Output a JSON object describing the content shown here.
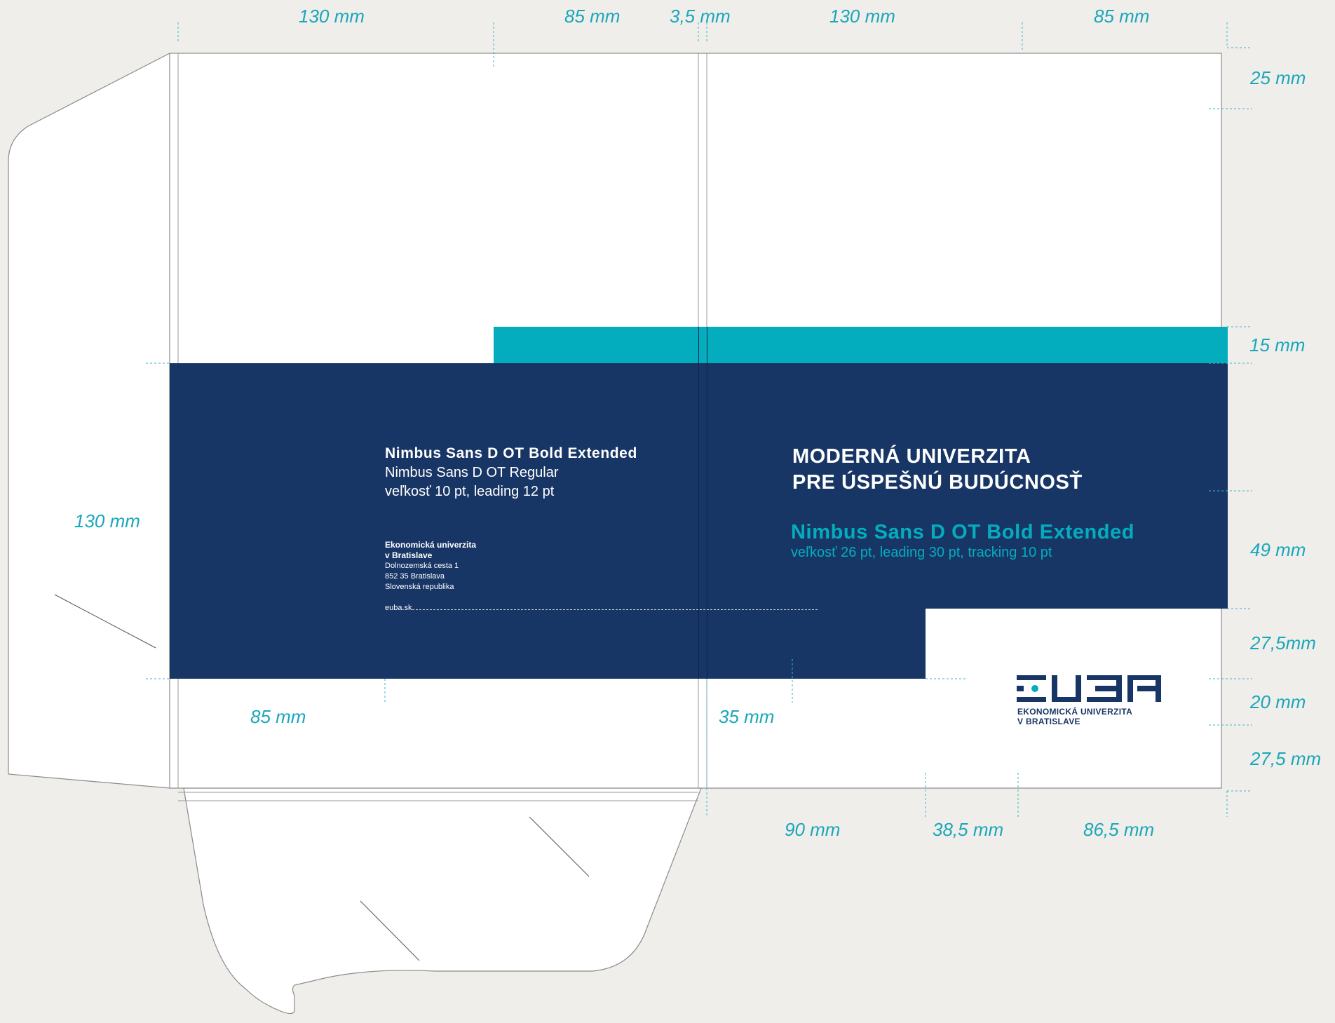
{
  "dimensions": {
    "top": [
      "130 mm",
      "85 mm",
      "3,5 mm",
      "130 mm",
      "85 mm"
    ],
    "right": [
      "25 mm",
      "15 mm",
      "49 mm",
      "27,5mm",
      "20 mm",
      "27,5 mm"
    ],
    "left": "130 mm",
    "bottom_left": [
      "85 mm",
      "35 mm"
    ],
    "bottom_right": [
      "90 mm",
      "38,5 mm",
      "86,5 mm"
    ]
  },
  "inner_panel": {
    "font_bold": "Nimbus Sans D OT Bold Extended",
    "font_regular": "Nimbus Sans D OT Regular",
    "font_spec": "veľkosť 10 pt, leading 12 pt",
    "address": {
      "line1": "Ekonomická univerzita",
      "line2": "v Bratislave",
      "line3": "Dolnozemská cesta 1",
      "line4": "852 35 Bratislava",
      "line5": "Slovenská republika"
    },
    "web": "euba.sk"
  },
  "cover": {
    "headline_line1": "MODERNÁ UNIVERZITA",
    "headline_line2": "PRE ÚSPEŠNÚ BUDÚCNOSŤ",
    "font_name": "Nimbus Sans D OT Bold Extended",
    "font_spec": "veľkosť 26 pt, leading 30 pt, tracking 10 pt"
  },
  "logo": {
    "line1": "EKONOMICKÁ UNIVERZITA",
    "line2": "V BRATISLAVE"
  },
  "colors": {
    "navy": "#183665",
    "teal": "#04adbe",
    "background": "#efeeeb",
    "dimension_text": "#1aa7b9"
  }
}
